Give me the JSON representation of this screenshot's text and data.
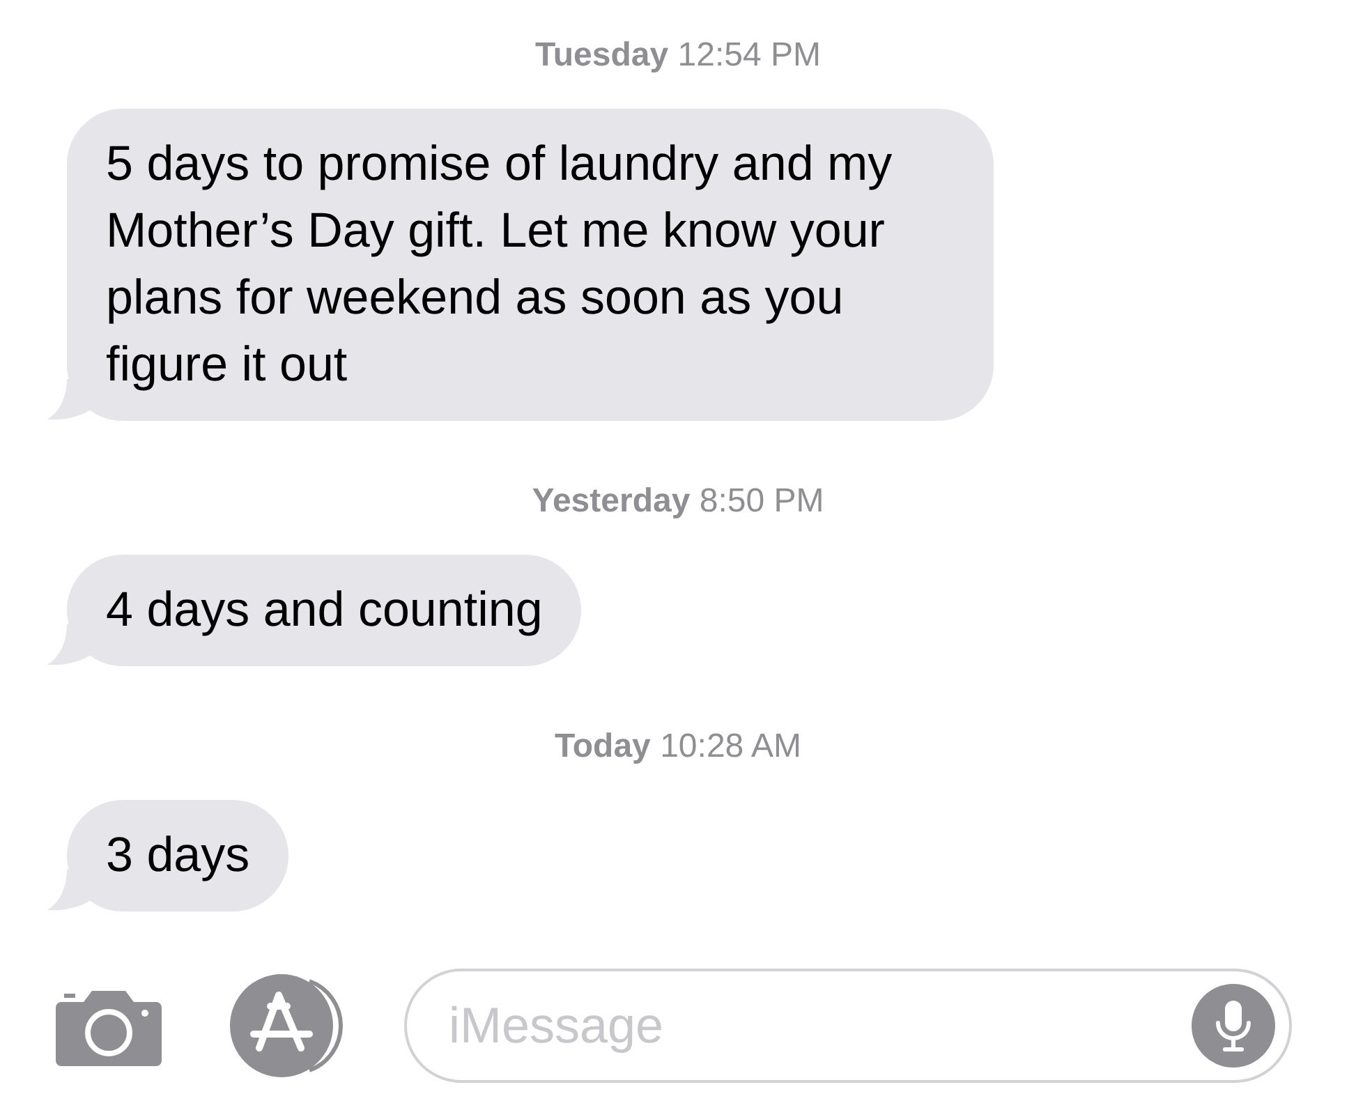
{
  "messages": [
    {
      "timestamp": "**Tuesday** 12:54 PM",
      "text": "5 days to promise of laundry and my Mother’s Day gift. Let me know your plans for weekend as soon as you figure it out"
    },
    {
      "timestamp": "**Yesterday** 8:50 PM",
      "text": "4 days and counting"
    },
    {
      "timestamp": "**Today** 10:28 AM",
      "text": "3 days"
    }
  ],
  "composer": {
    "placeholder": "iMessage"
  }
}
